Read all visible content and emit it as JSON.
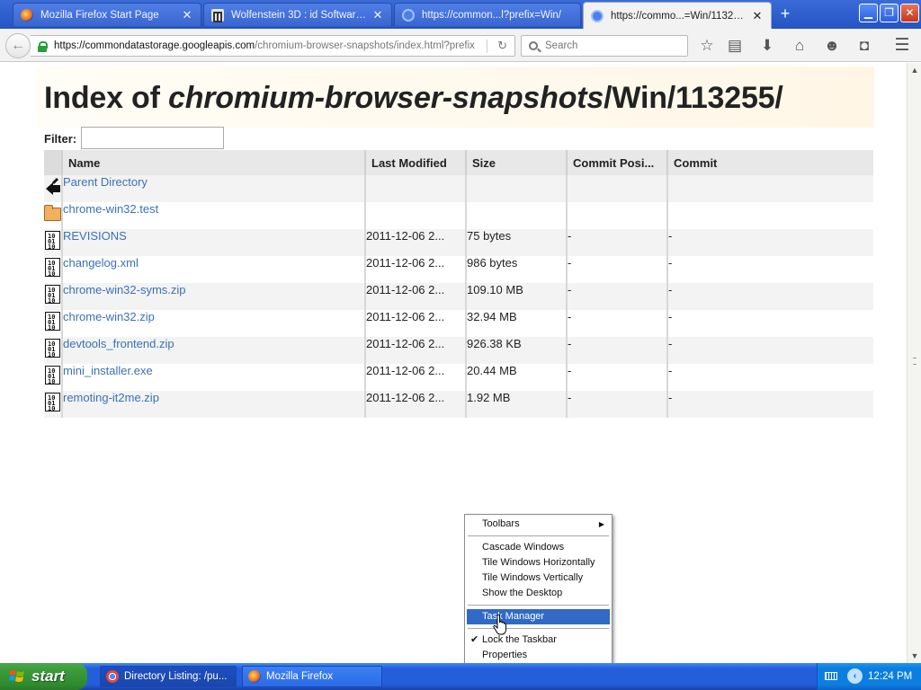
{
  "browser": {
    "tabs": [
      {
        "title": "Mozilla Firefox Start Page",
        "favicon": "firefox-icon",
        "active": false
      },
      {
        "title": "Wolfenstein 3D : id Software ...",
        "favicon": "bank-icon",
        "active": false
      },
      {
        "title": "https://common...l?prefix=Win/",
        "favicon": "globe-icon",
        "active": false
      },
      {
        "title": "https://commo...=Win/113255/",
        "favicon": "globe-icon",
        "active": true
      }
    ],
    "url_host": "https://commondatastorage.googleapis.com",
    "url_rest": "/chromium-browser-snapshots/index.html?prefix",
    "search_placeholder": "Search"
  },
  "page": {
    "title_prefix": "Index of ",
    "title_italic": "chromium-browser-snapshots",
    "title_suffix": "/Win/113255/",
    "filter_label": "Filter:",
    "filter_value": "",
    "columns": [
      "Name",
      "Last Modified",
      "Size",
      "Commit Posi...",
      "Commit"
    ],
    "rows": [
      {
        "name": "Parent Directory",
        "icon": "parent-icon",
        "date": "",
        "size": "",
        "commit_pos": "",
        "commit": ""
      },
      {
        "name": "chrome-win32.test",
        "icon": "folder-icon",
        "date": "",
        "size": "",
        "commit_pos": "",
        "commit": ""
      },
      {
        "name": "REVISIONS",
        "icon": "file-icon",
        "date": "2011-12-06 2...",
        "size": "75 bytes",
        "commit_pos": "-",
        "commit": "-"
      },
      {
        "name": "changelog.xml",
        "icon": "file-icon",
        "date": "2011-12-06 2...",
        "size": "986 bytes",
        "commit_pos": "-",
        "commit": "-"
      },
      {
        "name": "chrome-win32-syms.zip",
        "icon": "file-icon",
        "date": "2011-12-06 2...",
        "size": "109.10 MB",
        "commit_pos": "-",
        "commit": "-"
      },
      {
        "name": "chrome-win32.zip",
        "icon": "file-icon",
        "date": "2011-12-06 2...",
        "size": "32.94 MB",
        "commit_pos": "-",
        "commit": "-"
      },
      {
        "name": "devtools_frontend.zip",
        "icon": "file-icon",
        "date": "2011-12-06 2...",
        "size": "926.38 KB",
        "commit_pos": "-",
        "commit": "-"
      },
      {
        "name": "mini_installer.exe",
        "icon": "file-icon",
        "date": "2011-12-06 2...",
        "size": "20.44 MB",
        "commit_pos": "-",
        "commit": "-"
      },
      {
        "name": "remoting-it2me.zip",
        "icon": "file-icon",
        "date": "2011-12-06 2...",
        "size": "1.92 MB",
        "commit_pos": "-",
        "commit": "-"
      }
    ]
  },
  "context_menu": {
    "items": [
      "Toolbars",
      "Cascade Windows",
      "Tile Windows Horizontally",
      "Tile Windows Vertically",
      "Show the Desktop",
      "Task Manager",
      "Lock the Taskbar",
      "Properties"
    ],
    "highlighted": "Task Manager",
    "checked": "Lock the Taskbar"
  },
  "taskbar": {
    "start_label": "start",
    "buttons": [
      {
        "label": "Directory Listing: /pu...",
        "icon": "chrome-icon",
        "active": true
      },
      {
        "label": "Mozilla Firefox",
        "icon": "firefox-icon",
        "active": false
      }
    ],
    "clock": "12:24 PM"
  },
  "colors": {
    "link": "#3a70b8",
    "taskbar": "#245edb",
    "menu_highlight": "#316ac5",
    "start": "#3a9a3a"
  }
}
